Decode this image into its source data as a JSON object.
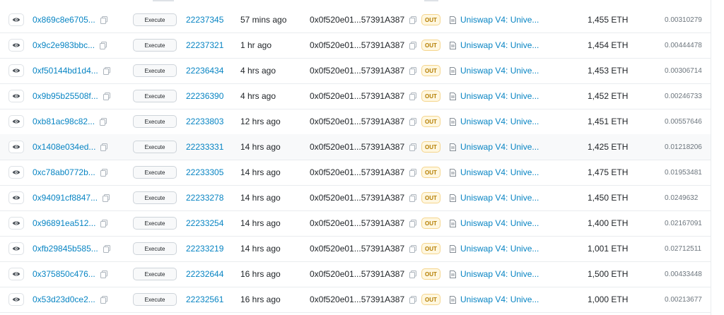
{
  "table": {
    "method_label": "Execute",
    "direction_label": "OUT",
    "rows": [
      {
        "hash": "0x869c8e6705...",
        "block": "22237345",
        "age": "57 mins ago",
        "from": "0x0f520e01...57391A387",
        "to": "Uniswap V4: Unive...",
        "amount": "1,455 ETH",
        "fee": "0.00310279"
      },
      {
        "hash": "0x9c2e983bbc...",
        "block": "22237321",
        "age": "1 hr ago",
        "from": "0x0f520e01...57391A387",
        "to": "Uniswap V4: Unive...",
        "amount": "1,454 ETH",
        "fee": "0.00444478"
      },
      {
        "hash": "0xf50144bd1d4...",
        "block": "22236434",
        "age": "4 hrs ago",
        "from": "0x0f520e01...57391A387",
        "to": "Uniswap V4: Unive...",
        "amount": "1,453 ETH",
        "fee": "0.00306714"
      },
      {
        "hash": "0x9b95b25508f...",
        "block": "22236390",
        "age": "4 hrs ago",
        "from": "0x0f520e01...57391A387",
        "to": "Uniswap V4: Unive...",
        "amount": "1,452 ETH",
        "fee": "0.00246733"
      },
      {
        "hash": "0xb81ac98c82...",
        "block": "22233803",
        "age": "12 hrs ago",
        "from": "0x0f520e01...57391A387",
        "to": "Uniswap V4: Unive...",
        "amount": "1,451 ETH",
        "fee": "0.00557646"
      },
      {
        "hash": "0x1408e034ed...",
        "block": "22233331",
        "age": "14 hrs ago",
        "from": "0x0f520e01...57391A387",
        "to": "Uniswap V4: Unive...",
        "amount": "1,425 ETH",
        "fee": "0.01218206"
      },
      {
        "hash": "0xc78ab0772b...",
        "block": "22233305",
        "age": "14 hrs ago",
        "from": "0x0f520e01...57391A387",
        "to": "Uniswap V4: Unive...",
        "amount": "1,475 ETH",
        "fee": "0.01953481"
      },
      {
        "hash": "0x94091cf8847...",
        "block": "22233278",
        "age": "14 hrs ago",
        "from": "0x0f520e01...57391A387",
        "to": "Uniswap V4: Unive...",
        "amount": "1,450 ETH",
        "fee": "0.0249632"
      },
      {
        "hash": "0x96891ea512...",
        "block": "22233254",
        "age": "14 hrs ago",
        "from": "0x0f520e01...57391A387",
        "to": "Uniswap V4: Unive...",
        "amount": "1,400 ETH",
        "fee": "0.02167091"
      },
      {
        "hash": "0xfb29845b585...",
        "block": "22233219",
        "age": "14 hrs ago",
        "from": "0x0f520e01...57391A387",
        "to": "Uniswap V4: Unive...",
        "amount": "1,001 ETH",
        "fee": "0.02712511"
      },
      {
        "hash": "0x375850c476...",
        "block": "22232644",
        "age": "16 hrs ago",
        "from": "0x0f520e01...57391A387",
        "to": "Uniswap V4: Unive...",
        "amount": "1,500 ETH",
        "fee": "0.00433448"
      },
      {
        "hash": "0x53d23d0ce2...",
        "block": "22232561",
        "age": "16 hrs ago",
        "from": "0x0f520e01...57391A387",
        "to": "Uniswap V4: Unive...",
        "amount": "1,000 ETH",
        "fee": "0.00213677"
      }
    ]
  }
}
